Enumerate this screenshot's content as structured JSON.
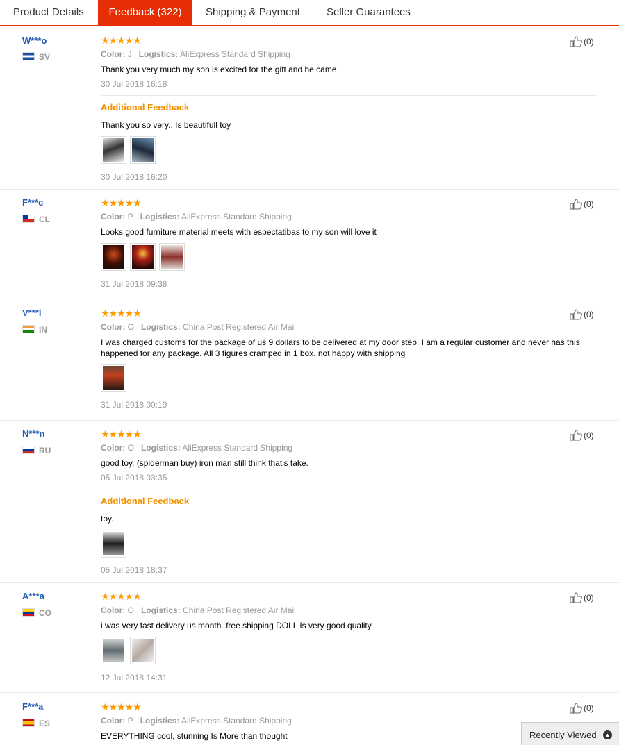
{
  "tabs": [
    {
      "label": "Product Details"
    },
    {
      "label": "Feedback (322)"
    },
    {
      "label": "Shipping & Payment"
    },
    {
      "label": "Seller Guarantees"
    }
  ],
  "labels": {
    "color": "Color:",
    "logistics": "Logistics:",
    "additional": "Additional Feedback"
  },
  "reviews": [
    {
      "user": "W***o",
      "country": "SV",
      "stars": "★★★★★",
      "color": "J",
      "logistics": "AliExpress Standard Shipping",
      "text": "Thank you very much my son is excited for the gift and he came",
      "date": "30 Jul 2018 16:18",
      "additional_text": "Thank you so very.. Is beautifull toy",
      "additional_date": "30 Jul 2018 16:20",
      "likes": "(0)"
    },
    {
      "user": "F***c",
      "country": "CL",
      "stars": "★★★★★",
      "color": "P",
      "logistics": "AliExpress Standard Shipping",
      "text": "Looks good furniture material meets with espectatibas to my son will love it",
      "date": "31 Jul 2018 09:38",
      "likes": "(0)"
    },
    {
      "user": "V***l",
      "country": "IN",
      "stars": "★★★★★",
      "color": "O",
      "logistics": "China Post Registered Air Mail",
      "text": "I was charged customs for the package of us 9 dollars to be delivered at my door step. I am a regular customer and never has this happened for any package. All 3 figures cramped in 1 box. not happy with shipping",
      "date": "31 Jul 2018 00:19",
      "likes": "(0)"
    },
    {
      "user": "N***n",
      "country": "RU",
      "stars": "★★★★★",
      "color": "O",
      "logistics": "AliExpress Standard Shipping",
      "text": "good toy. (spiderman buy) iron man still think that's take.",
      "date": "05 Jul 2018 03:35",
      "additional_text": "toy.",
      "additional_date": "05 Jul 2018 18:37",
      "likes": "(0)"
    },
    {
      "user": "A***a",
      "country": "CO",
      "stars": "★★★★★",
      "color": "O",
      "logistics": "China Post Registered Air Mail",
      "text": "i was very fast delivery us month. free shipping DOLL Is very good quality.",
      "date": "12 Jul 2018 14:31",
      "likes": "(0)"
    },
    {
      "user": "F***a",
      "country": "ES",
      "stars": "★★★★★",
      "color": "P",
      "logistics": "AliExpress Standard Shipping",
      "text": "EVERYTHING cool, stunning Is More than thought",
      "likes": "(0)"
    }
  ],
  "recently_viewed": "Recently Viewed",
  "colors": {
    "accent": "#e62e04",
    "star": "#ff9a00",
    "additional": "#f29000",
    "user": "#225bb6"
  }
}
